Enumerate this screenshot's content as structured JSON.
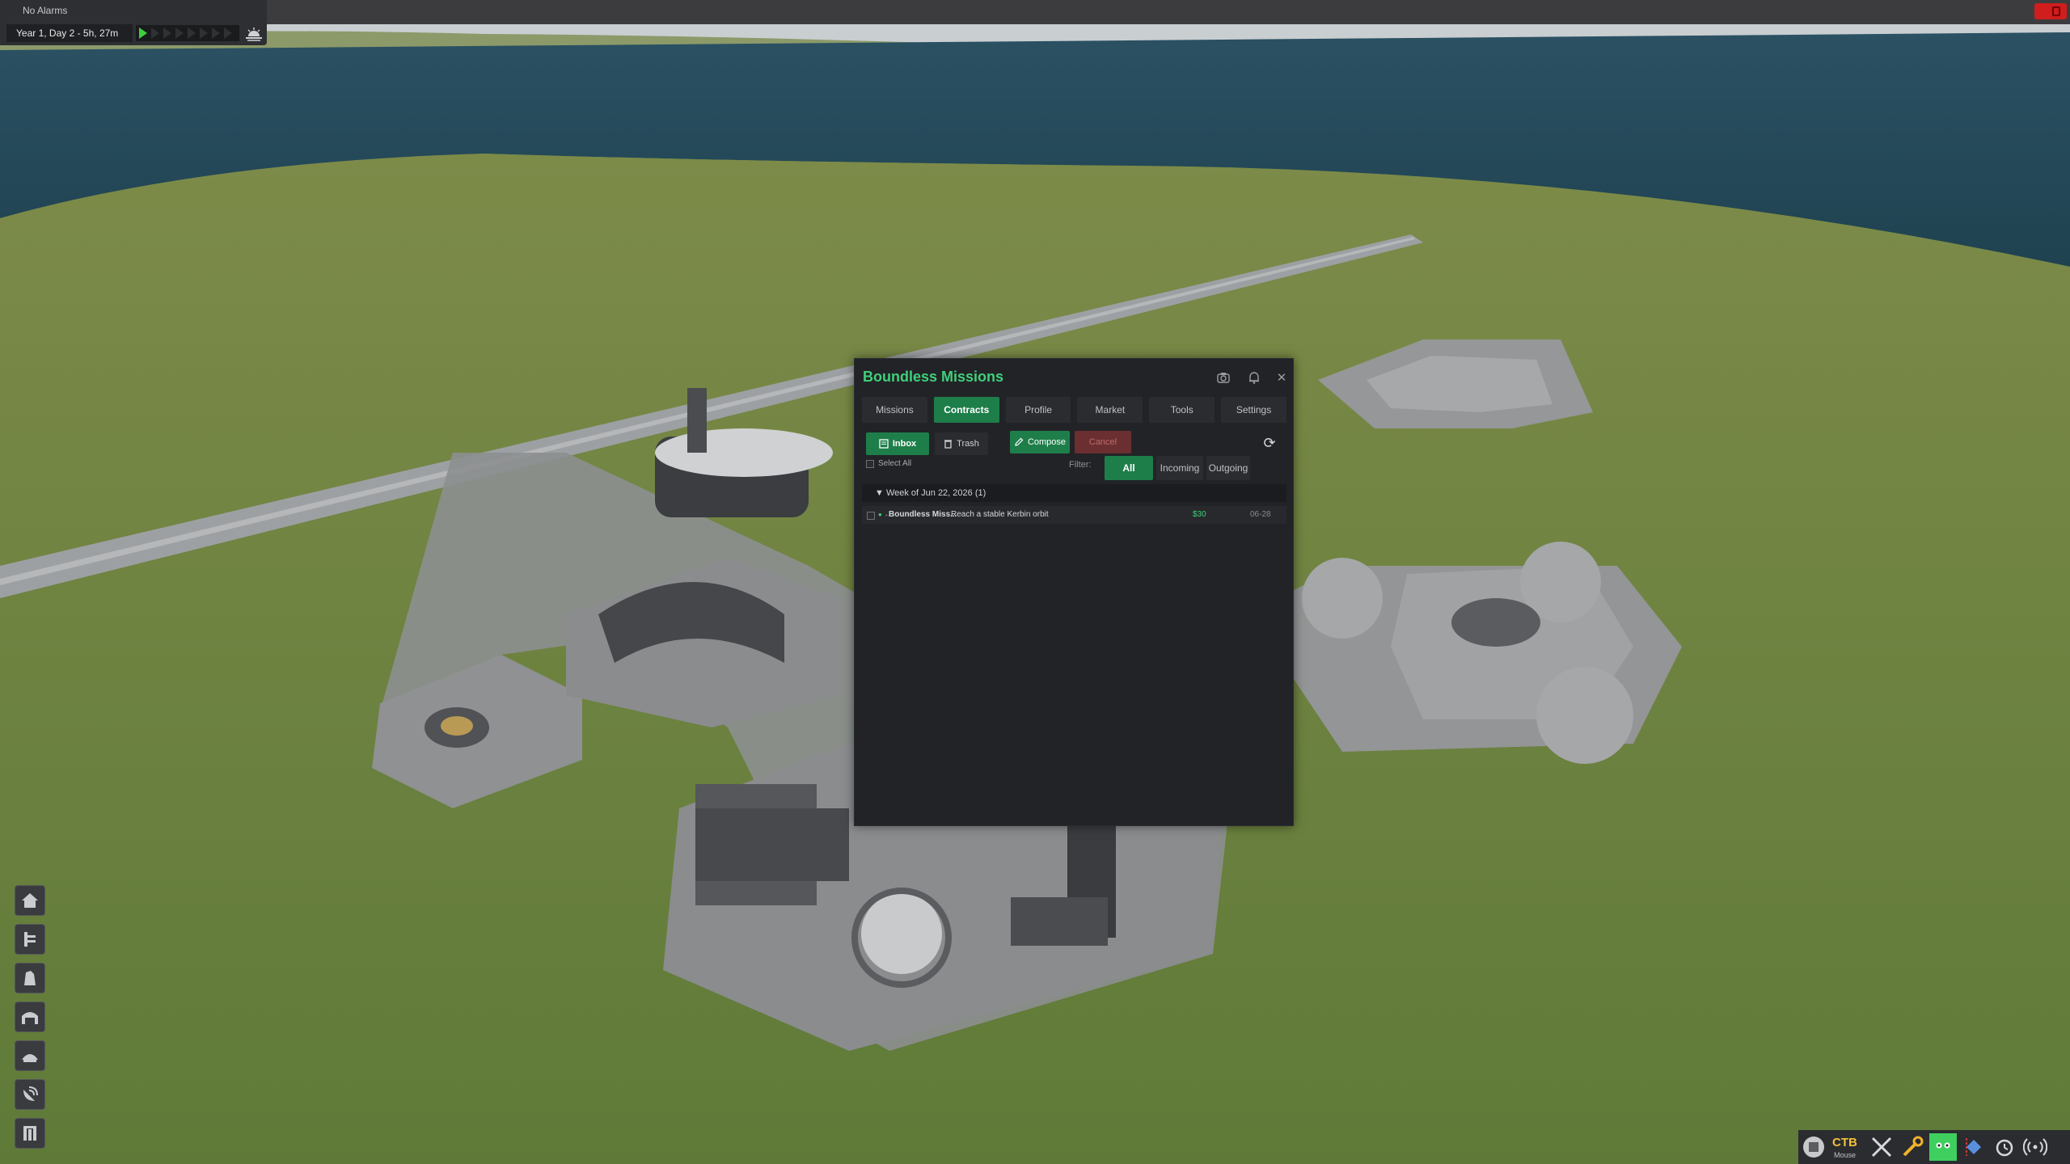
{
  "topbar": {
    "alarm_text": "No Alarms",
    "date_text": "Year 1, Day 2 - 5h, 27m",
    "warp_levels": 8,
    "warp_active": 1
  },
  "dialog": {
    "title": "Boundless Missions",
    "tabs": [
      {
        "label": "Missions",
        "active": false
      },
      {
        "label": "Contracts",
        "active": true
      },
      {
        "label": "Profile",
        "active": false
      },
      {
        "label": "Market",
        "active": false
      },
      {
        "label": "Tools",
        "active": false
      },
      {
        "label": "Settings",
        "active": false
      }
    ],
    "buttons": {
      "inbox": "Inbox",
      "trash": "Trash",
      "compose": "Compose",
      "cancel": "Cancel"
    },
    "select_all": "Select All",
    "filter_label": "Filter:",
    "filters": [
      {
        "label": "All",
        "active": true
      },
      {
        "label": "Incoming",
        "active": false
      },
      {
        "label": "Outgoing",
        "active": false
      }
    ],
    "group_header": "▼ Week of Jun 22, 2026 (1)",
    "messages": [
      {
        "from": "Boundless Miss...",
        "subject": "Reach a stable Kerbin orbit",
        "amount": "$30",
        "date": "06-28"
      }
    ]
  },
  "bottom_toolbar": {
    "ctb_label": "CTB",
    "ctb_sub": "Mouse"
  },
  "colors": {
    "accent_green": "#1e7e4a",
    "title_green": "#3fd07a",
    "cancel_red": "#6b2f31",
    "panel_bg": "#222327"
  }
}
